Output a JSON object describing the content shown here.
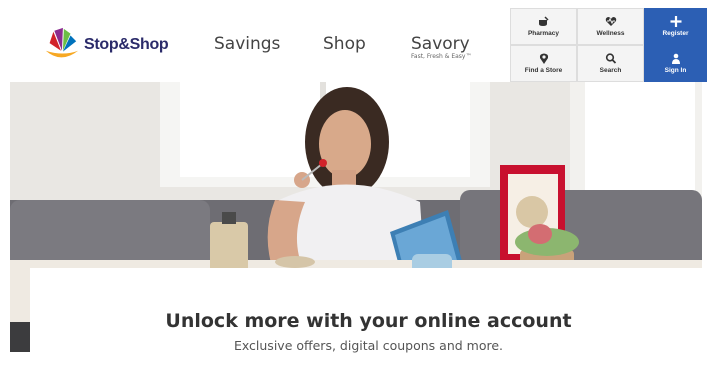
{
  "brand": {
    "name": "Stop&Shop"
  },
  "nav": {
    "savings": "Savings",
    "shop": "Shop",
    "savory": "Savory",
    "savory_tagline": "Fast, Fresh & Easy™"
  },
  "utility": [
    {
      "label": "Pharmacy",
      "icon": "pharmacy-icon"
    },
    {
      "label": "Wellness",
      "icon": "heart-pulse-icon"
    },
    {
      "label": "Register",
      "icon": "plus-icon"
    },
    {
      "label": "Find a Store",
      "icon": "map-pin-icon"
    },
    {
      "label": "Search",
      "icon": "search-icon"
    },
    {
      "label": "Sign In",
      "icon": "user-icon"
    }
  ],
  "hero": {
    "image": "woman-with-tablet-breakfast"
  },
  "promo": {
    "title": "Unlock more with your online account",
    "subtitle": "Exclusive offers, digital coupons and more."
  },
  "colors": {
    "accent_blue": "#2c5fb4",
    "brand_navy": "#2b2b6a"
  }
}
